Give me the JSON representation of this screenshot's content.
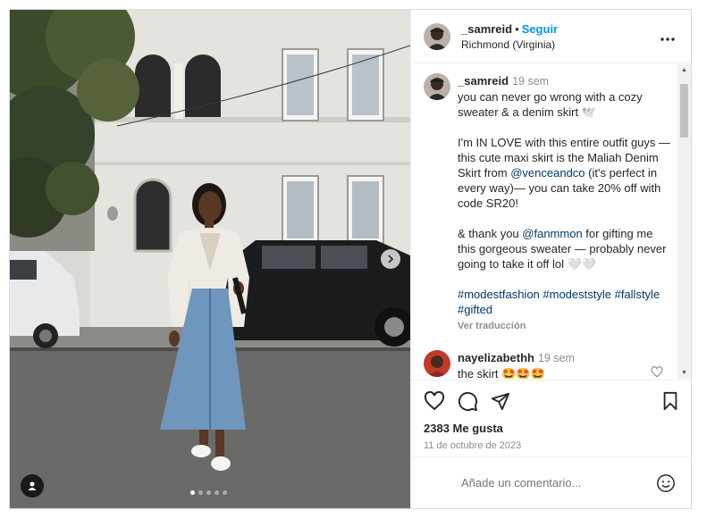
{
  "post": {
    "author": "_samreid",
    "follow_label": "Seguir",
    "location": "Richmond (Virginia)",
    "carousel": {
      "current": 1,
      "total": 5
    }
  },
  "caption": {
    "username": "_samreid",
    "time": "19 sem",
    "line1": "you can never go wrong with a cozy sweater & a denim skirt 🕊️",
    "p2_a": "I'm IN LOVE with this entire outfit guys — this cute maxi skirt is the Maliah Denim Skirt from ",
    "p2_mention": "@venceandco",
    "p2_b": " (it's perfect in every way)— you can take 20% off with code SR20!",
    "p3_a": "& thank you ",
    "p3_mention": "@fanmmon",
    "p3_b": " for gifting me this gorgeous sweater — probably never going to take it off lol 🤍🤍",
    "hashtags": "#modestfashion #modeststyle #fallstyle #gifted",
    "translate": "Ver traducción"
  },
  "comments": [
    {
      "username": "nayelizabethh",
      "time": "19 sem",
      "text": "the skirt 🤩🤩🤩"
    }
  ],
  "likes": "2383 Me gusta",
  "date": "11 de octubre de 2023",
  "comment_placeholder": "Añade un comentario...",
  "icons": [
    "heart-icon",
    "comment-icon",
    "share-icon",
    "bookmark-icon",
    "more-icon",
    "emoji-icon",
    "chevron-right-icon",
    "user-tag-icon"
  ],
  "colors": {
    "link": "#0095f6",
    "mention": "#00376b",
    "muted": "#8e8e8e"
  }
}
